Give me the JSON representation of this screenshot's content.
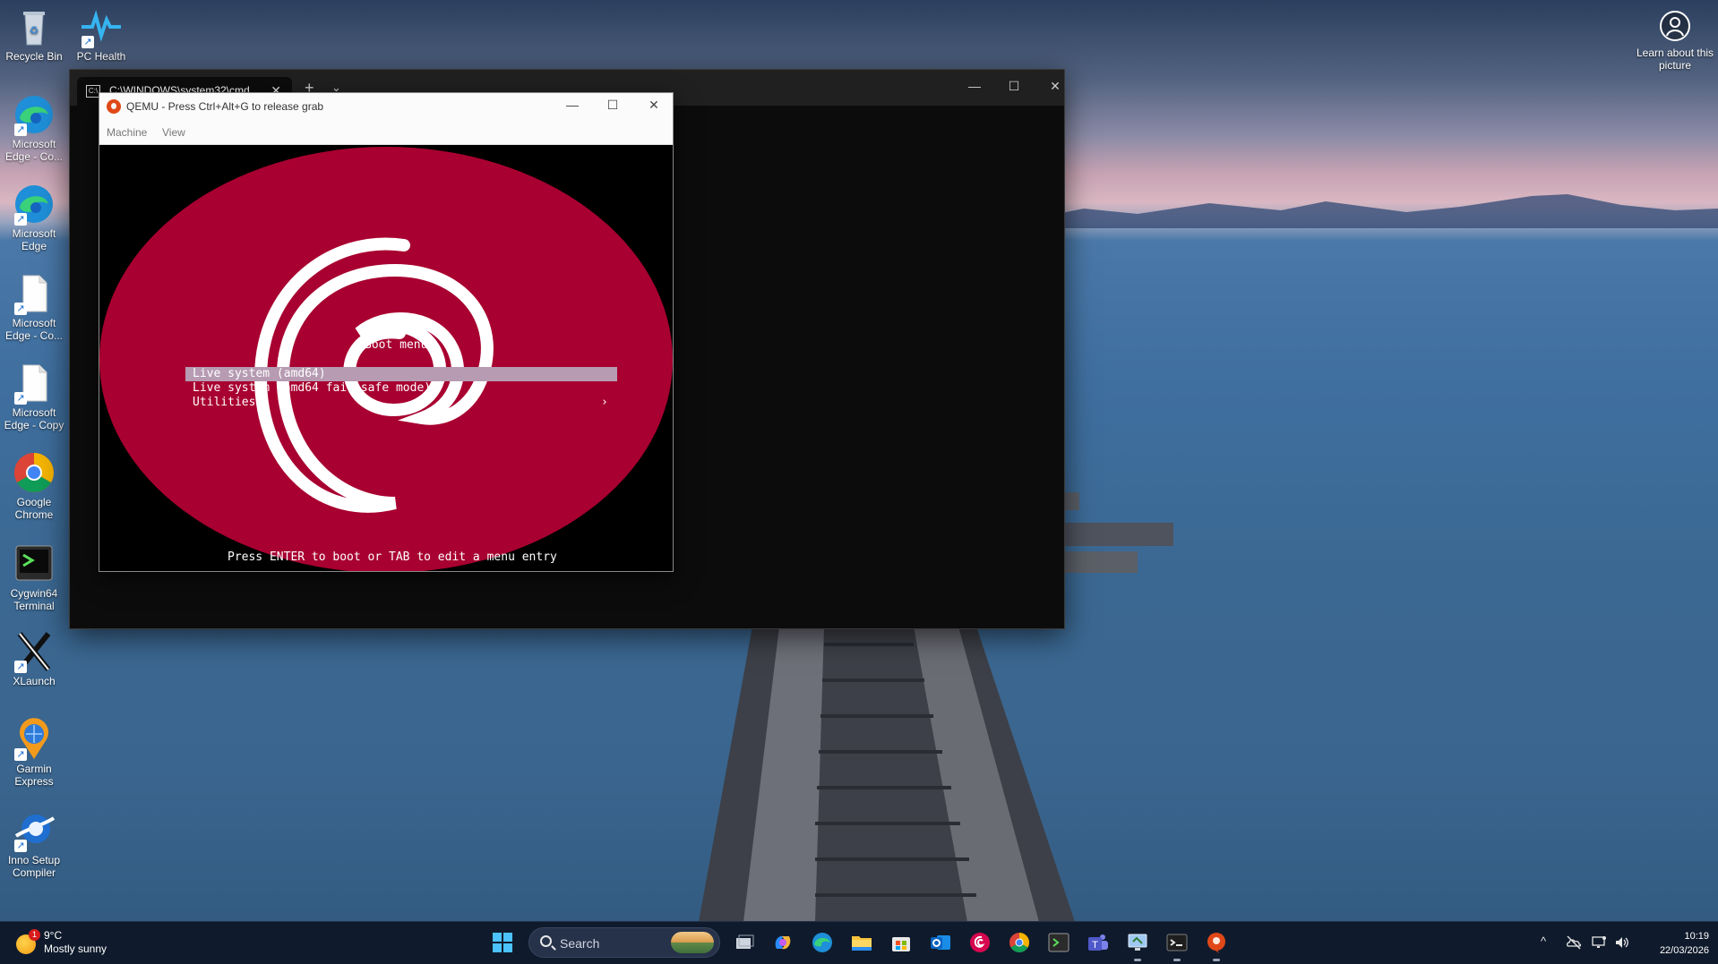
{
  "desktop": {
    "icons": [
      {
        "label": "Recycle Bin"
      },
      {
        "label": "PC Health Check"
      },
      {
        "label": "Microsoft Edge - Co..."
      },
      {
        "label": "Microsoft Edge"
      },
      {
        "label": "Microsoft Edge - Co..."
      },
      {
        "label": "Microsoft Edge - Copy"
      },
      {
        "label": "Google Chrome"
      },
      {
        "label": "Cygwin64 Terminal"
      },
      {
        "label": "XLaunch"
      },
      {
        "label": "Garmin Express"
      },
      {
        "label": "Inno Setup Compiler"
      }
    ],
    "learn_label": "Learn about this picture"
  },
  "terminal": {
    "tab_title": "C:\\WINDOWS\\system32\\cmd",
    "new_tab": "+",
    "dropdown": "⌄",
    "close_tab": "✕",
    "minimize": "—",
    "maximize": "☐",
    "close": "✕"
  },
  "qemu": {
    "title": "QEMU - Press Ctrl+Alt+G to release grab",
    "minimize": "—",
    "maximize": "☐",
    "close": "✕",
    "menu": [
      "Machine",
      "View"
    ],
    "boot_menu": {
      "title": "Boot menu",
      "items": [
        "Live system (amd64)",
        "Live system (amd64 fail-safe mode)",
        "Utilities"
      ],
      "submenu_arrow": "›",
      "selected_index": 0,
      "hint": "Press ENTER to boot or TAB to edit a menu entry"
    },
    "colors": {
      "circle": "#a80030",
      "selection": "#b69bb2"
    }
  },
  "taskbar": {
    "weather": {
      "temp": "9°C",
      "condition": "Mostly sunny",
      "badge": "1"
    },
    "search_placeholder": "Search",
    "pinned": [
      "start-icon",
      "task-view-icon",
      "copilot-icon",
      "edge-icon",
      "file-explorer-icon",
      "store-icon",
      "outlook-icon",
      "debian-icon",
      "chrome-icon",
      "cygwin-icon",
      "teams-icon",
      "remote-desktop-icon",
      "terminal-icon",
      "qemu-icon"
    ],
    "tray_chevron": "^",
    "time": "10:19",
    "date": "22/03/2026"
  }
}
